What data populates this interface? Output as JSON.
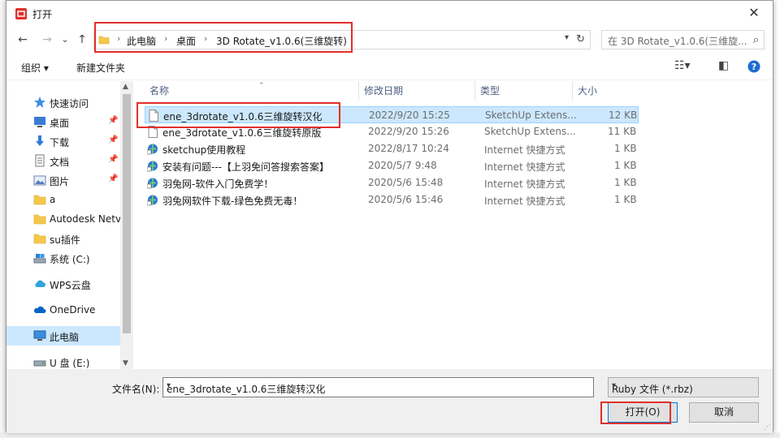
{
  "window": {
    "title": "打开",
    "close_glyph": "✕"
  },
  "nav": {
    "back": "←",
    "forward": "→",
    "recent": "⌄",
    "up": "↑",
    "breadcrumbs": [
      "此电脑",
      "桌面",
      "3D Rotate_v1.0.6(三维旋转)"
    ],
    "separator": "›",
    "search_placeholder": "在 3D Rotate_v1.0.6(三维旋...",
    "icons": {
      "search": "search-icon",
      "refresh": "refresh-icon"
    }
  },
  "toolbar": {
    "organize": "组织 ▾",
    "new_folder": "新建文件夹"
  },
  "sidebar": {
    "items": [
      {
        "label": "快速访问",
        "icon": "star-icon",
        "pinned": false
      },
      {
        "label": "桌面",
        "icon": "desktop-icon",
        "pinned": true
      },
      {
        "label": "下载",
        "icon": "download-icon",
        "pinned": true
      },
      {
        "label": "文档",
        "icon": "document-icon",
        "pinned": true
      },
      {
        "label": "图片",
        "icon": "picture-icon",
        "pinned": true
      },
      {
        "label": "a",
        "icon": "folder-icon",
        "pinned": false
      },
      {
        "label": "Autodesk Netv",
        "icon": "folder-icon",
        "pinned": false
      },
      {
        "label": "su插件",
        "icon": "folder-icon",
        "pinned": false
      },
      {
        "label": "系统 (C:)",
        "icon": "drive-icon",
        "pinned": false
      },
      {
        "label": "WPS云盘",
        "icon": "cloud-icon",
        "pinned": false
      },
      {
        "label": "OneDrive",
        "icon": "onedrive-icon",
        "pinned": false
      },
      {
        "label": "此电脑",
        "icon": "computer-icon",
        "pinned": false,
        "selected": true
      },
      {
        "label": "U 盘 (E:)",
        "icon": "usb-drive-icon",
        "pinned": false
      }
    ]
  },
  "columns": {
    "name": "名称",
    "modified": "修改日期",
    "type": "类型",
    "size": "大小"
  },
  "files": [
    {
      "name": "ene_3drotate_v1.0.6三维旋转汉化",
      "modified": "2022/9/20 15:25",
      "type": "SketchUp Extens...",
      "size": "12 KB",
      "icon": "file-icon",
      "selected": true
    },
    {
      "name": "ene_3drotate_v1.0.6三维旋转原版",
      "modified": "2022/9/20 15:26",
      "type": "SketchUp Extens...",
      "size": "11 KB",
      "icon": "file-icon"
    },
    {
      "name": "sketchup使用教程",
      "modified": "2022/8/17 10:24",
      "type": "Internet 快捷方式",
      "size": "1 KB",
      "icon": "internet-shortcut-icon"
    },
    {
      "name": "安装有问题---【上羽免问答搜索答案】",
      "modified": "2020/5/7 9:48",
      "type": "Internet 快捷方式",
      "size": "1 KB",
      "icon": "internet-shortcut-icon"
    },
    {
      "name": "羽兔网-软件入门免费学！",
      "modified": "2020/5/6 15:48",
      "type": "Internet 快捷方式",
      "size": "1 KB",
      "icon": "internet-shortcut-icon"
    },
    {
      "name": "羽兔网软件下载-绿色免费无毒！",
      "modified": "2020/5/6 15:46",
      "type": "Internet 快捷方式",
      "size": "1 KB",
      "icon": "internet-shortcut-icon"
    }
  ],
  "footer": {
    "filename_label": "文件名(N):",
    "filename_value": "ene_3drotate_v1.0.6三维旋转汉化",
    "filetype_value": "Ruby 文件 (*.rbz)",
    "open_button": "打开(O)",
    "cancel_button": "取消"
  },
  "colors": {
    "accent": "#0078d7",
    "selection": "#cce8ff",
    "annotation_red": "#e0302a"
  }
}
